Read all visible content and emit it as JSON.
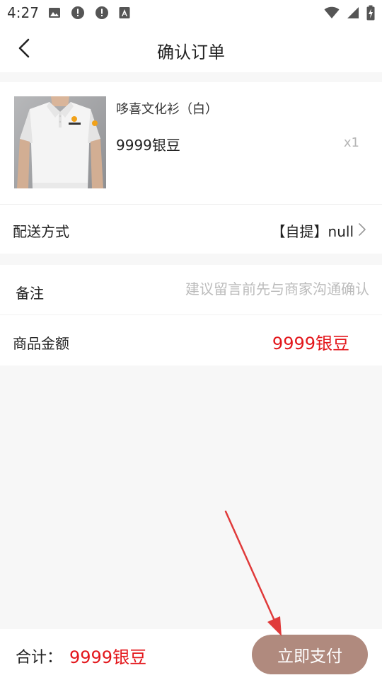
{
  "status_bar": {
    "time": "4:27",
    "left_icons": [
      "image-icon",
      "alert-icon",
      "alert-icon",
      "font-a-icon"
    ],
    "right_icons": [
      "wifi-icon",
      "signal-icon",
      "battery-charging-icon"
    ]
  },
  "header": {
    "title": "确认订单",
    "back_icon": "chevron-left-icon"
  },
  "product": {
    "name": "哆喜文化衫（白）",
    "price": "9999银豆",
    "quantity": "x1",
    "image_icon": "white-polo-shirt-image"
  },
  "delivery": {
    "label": "配送方式",
    "value": "【自提】null",
    "chevron_icon": "chevron-right-icon"
  },
  "remark": {
    "label": "备注",
    "placeholder": "建议留言前先与商家沟通确认"
  },
  "amount": {
    "label": "商品金额",
    "value": "9999银豆"
  },
  "footer": {
    "total_label": "合计：",
    "total_value": "9999银豆",
    "pay_button": "立即支付"
  },
  "colors": {
    "price_red": "#e3161b",
    "pay_button_bg": "#b08a7e",
    "annotation_arrow": "#e03a3a"
  }
}
